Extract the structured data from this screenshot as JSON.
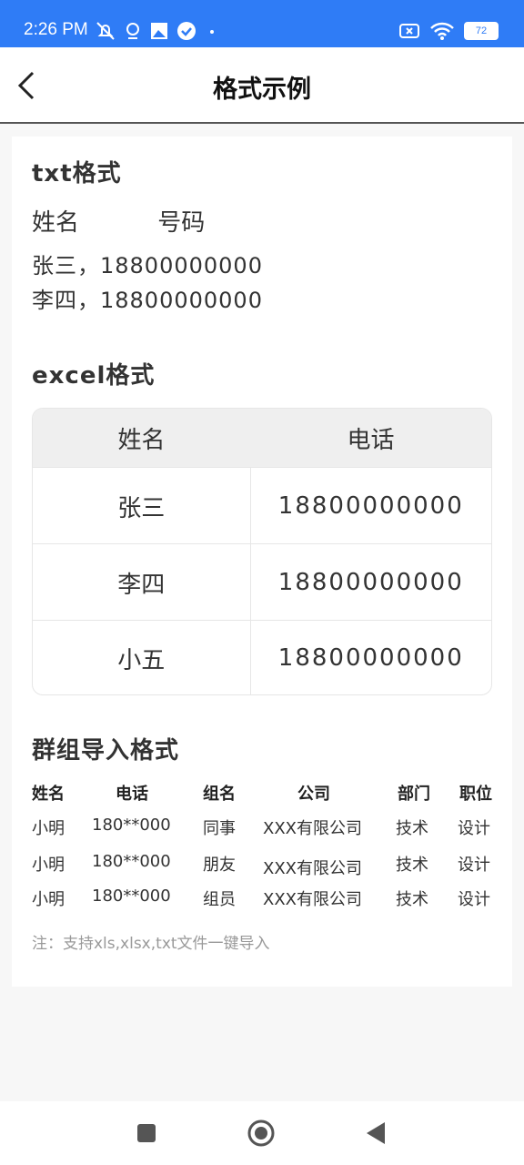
{
  "status_bar": {
    "time": "2:26 PM",
    "battery": "72",
    "left_icons": [
      "bell-off-icon",
      "location-icon",
      "image-icon",
      "check-circle-icon",
      "dot-icon"
    ],
    "right_icons": [
      "sim-x-icon",
      "wifi-icon",
      "battery-icon"
    ],
    "color": "#2f7cf6"
  },
  "app_bar": {
    "title": "格式示例",
    "back_icon": "chevron-left-icon"
  },
  "txt_section": {
    "heading": "txt格式",
    "col_name": "姓名",
    "col_number": "号码",
    "lines": [
      "张三，18800000000",
      "李四，18800000000"
    ]
  },
  "excel_section": {
    "heading": "excel格式",
    "headers": [
      "姓名",
      "电话"
    ],
    "rows": [
      [
        "张三",
        "18800000000"
      ],
      [
        "李四",
        "18800000000"
      ],
      [
        "小五",
        "18800000000"
      ]
    ]
  },
  "group_section": {
    "heading": "群组导入格式",
    "headers": [
      "姓名",
      "电话",
      "组名",
      "公司",
      "部门",
      "职位"
    ],
    "rows": [
      [
        "小明",
        "180**000",
        "同事",
        "XXX有限公司",
        "技术",
        "设计"
      ],
      [
        "小明",
        "180**000",
        "朋友",
        "XXX有限公司",
        "技术",
        "设计"
      ],
      [
        "小明",
        "180**000",
        "组员",
        "XXX有限公司",
        "技术",
        "设计"
      ]
    ],
    "note": "注：支持xls,xlsx,txt文件一键导入"
  },
  "nav_bar": {
    "icons": [
      "square-recents-icon",
      "circle-home-icon",
      "triangle-back-icon"
    ]
  }
}
